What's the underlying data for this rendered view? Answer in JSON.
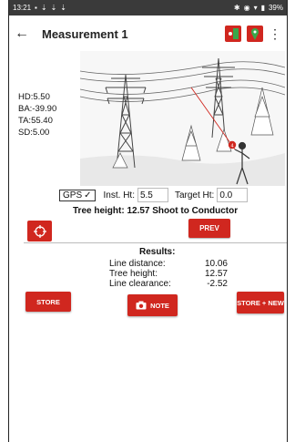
{
  "status": {
    "time": "13:21",
    "right_text": "39%"
  },
  "header": {
    "title": "Measurement 1"
  },
  "readouts": {
    "hd": "HD:5.50",
    "ba": "BA:-39.90",
    "ta": "TA:55.40",
    "sd": "SD:5.00"
  },
  "scene": {
    "marker_label": "4"
  },
  "controls": {
    "gps_label": "GPS",
    "gps_check": "✓",
    "inst_label": "Inst. Ht:",
    "inst_value": "5.5",
    "target_label": "Target Ht:",
    "target_value": "0.0"
  },
  "summary": "Tree height: 12.57   Shoot to Conductor",
  "buttons": {
    "prev": "PREV",
    "store": "STORE",
    "note": "NOTE",
    "store_new": "STORE + NEW"
  },
  "results": {
    "title": "Results:",
    "rows": [
      {
        "label": "Line distance:",
        "value": "10.06"
      },
      {
        "label": "Tree height:",
        "value": "12.57"
      },
      {
        "label": "Line clearance:",
        "value": "-2.52"
      }
    ]
  },
  "colors": {
    "accent": "#d0271f",
    "green": "#3aa64a",
    "statusbar": "#3a3a3a"
  }
}
